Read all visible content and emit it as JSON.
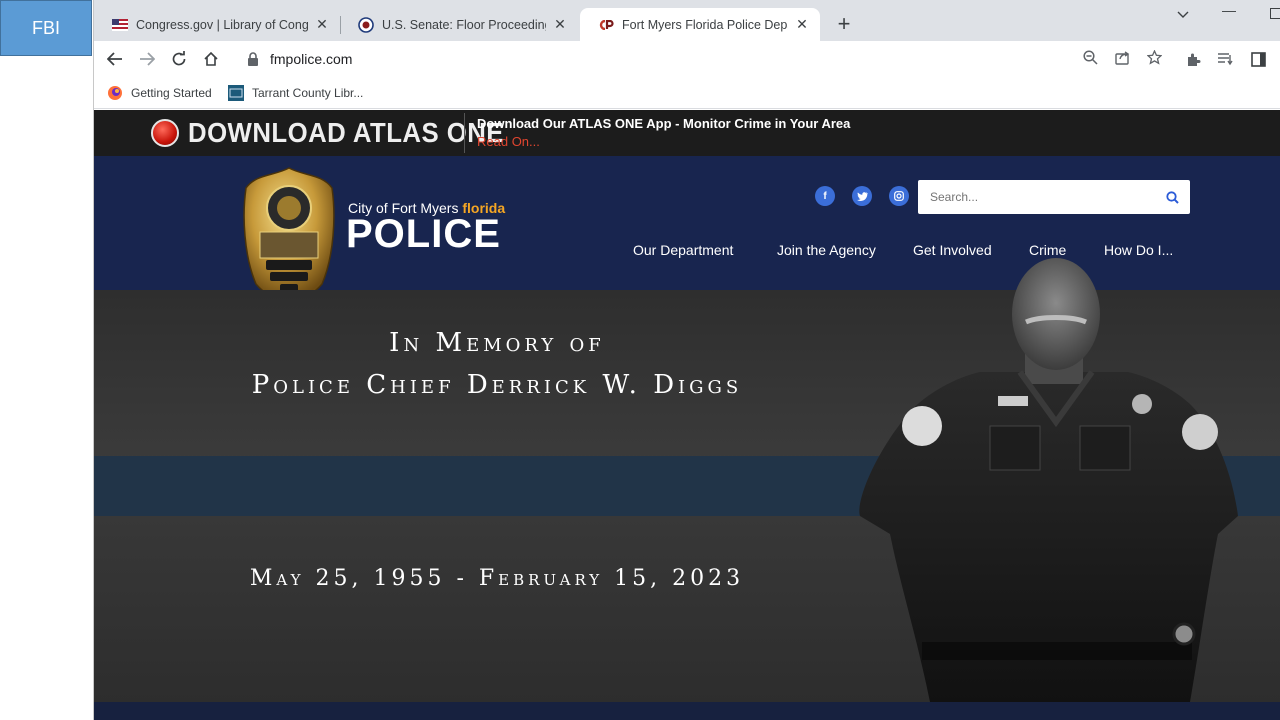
{
  "desktop": {
    "tile_label": "FBI"
  },
  "tabs": [
    {
      "title": "Congress.gov | Library of Congre",
      "favicon": "us-flag-icon"
    },
    {
      "title": "U.S. Senate: Floor Proceedings",
      "favicon": "senate-seal-icon"
    },
    {
      "title": "Fort Myers Florida Police Departm",
      "favicon": "cp-logo-icon",
      "active": true
    }
  ],
  "address_bar": {
    "url": "fmpolice.com"
  },
  "bookmarks": [
    {
      "label": "Getting Started"
    },
    {
      "label": "Tarrant County Libr..."
    }
  ],
  "site": {
    "atlas": {
      "title": "DOWNLOAD ATLAS ONE",
      "message": "Download Our ATLAS ONE App - Monitor Crime in Your Area",
      "link": "Read On..."
    },
    "brand": {
      "sub_prefix": "City of Fort Myers",
      "sub_accent": "florida",
      "main": "POLICE"
    },
    "search": {
      "placeholder": "Search..."
    },
    "nav": [
      "Our Department",
      "Join the Agency",
      "Get Involved",
      "Crime",
      "How Do I..."
    ],
    "hero": {
      "line1": "In Memory of",
      "line2": "Police Chief Derrick W. Diggs",
      "dates": "May 25, 1955 - February 15, 2023"
    }
  },
  "colors": {
    "header_bg": "#18254f",
    "atlas_bar": "#1c1c1c",
    "accent_orange": "#f5a623",
    "link_red": "#e0452f",
    "social_blue": "#3b6ed8"
  }
}
